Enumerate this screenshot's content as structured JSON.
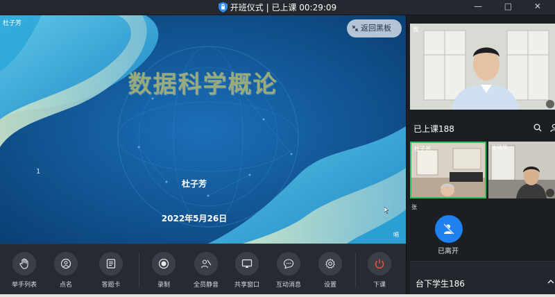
{
  "titlebar": {
    "title": "开班仪式 | 已上课 00:29:09",
    "window_controls": "— □ ✕"
  },
  "stage": {
    "presenter_name": "杜子芳",
    "back_button_label": "返回黑板",
    "slide": {
      "title": "数据科学概论",
      "author": "杜子芳",
      "date": "2022年5月26日",
      "page_number": "1"
    },
    "corner_badge": "嗝"
  },
  "toolbar": {
    "items": [
      {
        "label": "举手列表",
        "icon": "raise-hand-icon"
      },
      {
        "label": "点名",
        "icon": "location-pin-icon"
      },
      {
        "label": "答题卡",
        "icon": "answer-card-icon"
      },
      {
        "label": "录制",
        "icon": "record-icon"
      },
      {
        "label": "全员静音",
        "icon": "mute-all-icon"
      },
      {
        "label": "共享窗口",
        "icon": "share-screen-icon"
      },
      {
        "label": "互动消息",
        "icon": "chat-bubble-icon"
      },
      {
        "label": "设置",
        "icon": "gear-icon"
      },
      {
        "label": "下课",
        "icon": "power-icon"
      }
    ],
    "end_class_color": "#e8503a"
  },
  "sidebar": {
    "teacher_label": "我",
    "class_heading": "已上课188",
    "students": [
      {
        "name": "杜子芳"
      },
      {
        "name": "张晓华"
      },
      {
        "name": "张",
        "status": "已离开"
      }
    ],
    "below_heading": "台下学生186"
  },
  "colors": {
    "active_border": "#2fc25b",
    "left_badge": "#1f80f0"
  }
}
